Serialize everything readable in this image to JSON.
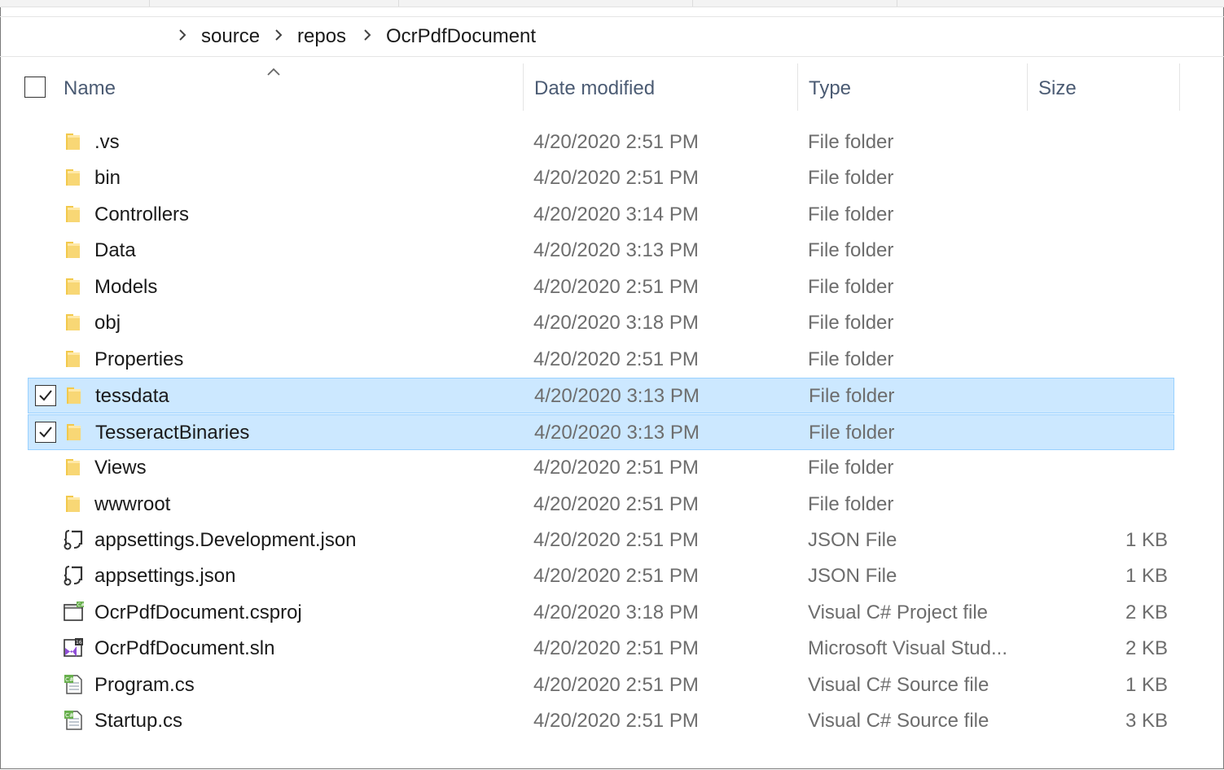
{
  "breadcrumb": {
    "items": [
      "source",
      "repos",
      "OcrPdfDocument"
    ]
  },
  "columns": {
    "name": "Name",
    "date_modified": "Date modified",
    "type": "Type",
    "size": "Size",
    "sort_icon": "chevron-up-icon"
  },
  "colors": {
    "selection_bg": "#cce8ff",
    "selection_border": "#99d1ff",
    "folder": "#f8d775",
    "header_text": "#4b5b73"
  },
  "files": [
    {
      "name": ".vs",
      "date": "4/20/2020 2:51 PM",
      "type": "File folder",
      "size": "",
      "icon": "folder-icon",
      "selected": false
    },
    {
      "name": "bin",
      "date": "4/20/2020 2:51 PM",
      "type": "File folder",
      "size": "",
      "icon": "folder-icon",
      "selected": false
    },
    {
      "name": "Controllers",
      "date": "4/20/2020 3:14 PM",
      "type": "File folder",
      "size": "",
      "icon": "folder-icon",
      "selected": false
    },
    {
      "name": "Data",
      "date": "4/20/2020 3:13 PM",
      "type": "File folder",
      "size": "",
      "icon": "folder-icon",
      "selected": false
    },
    {
      "name": "Models",
      "date": "4/20/2020 2:51 PM",
      "type": "File folder",
      "size": "",
      "icon": "folder-icon",
      "selected": false
    },
    {
      "name": "obj",
      "date": "4/20/2020 3:18 PM",
      "type": "File folder",
      "size": "",
      "icon": "folder-icon",
      "selected": false
    },
    {
      "name": "Properties",
      "date": "4/20/2020 2:51 PM",
      "type": "File folder",
      "size": "",
      "icon": "folder-icon",
      "selected": false
    },
    {
      "name": "tessdata",
      "date": "4/20/2020 3:13 PM",
      "type": "File folder",
      "size": "",
      "icon": "folder-icon",
      "selected": true
    },
    {
      "name": "TesseractBinaries",
      "date": "4/20/2020 3:13 PM",
      "type": "File folder",
      "size": "",
      "icon": "folder-icon",
      "selected": true
    },
    {
      "name": "Views",
      "date": "4/20/2020 2:51 PM",
      "type": "File folder",
      "size": "",
      "icon": "folder-icon",
      "selected": false
    },
    {
      "name": "wwwroot",
      "date": "4/20/2020 2:51 PM",
      "type": "File folder",
      "size": "",
      "icon": "folder-icon",
      "selected": false
    },
    {
      "name": "appsettings.Development.json",
      "date": "4/20/2020 2:51 PM",
      "type": "JSON File",
      "size": "1 KB",
      "icon": "json-file-icon",
      "selected": false
    },
    {
      "name": "appsettings.json",
      "date": "4/20/2020 2:51 PM",
      "type": "JSON File",
      "size": "1 KB",
      "icon": "json-file-icon",
      "selected": false
    },
    {
      "name": "OcrPdfDocument.csproj",
      "date": "4/20/2020 3:18 PM",
      "type": "Visual C# Project file",
      "size": "2 KB",
      "icon": "csproj-file-icon",
      "selected": false
    },
    {
      "name": "OcrPdfDocument.sln",
      "date": "4/20/2020 2:51 PM",
      "type": "Microsoft Visual Stud...",
      "size": "2 KB",
      "icon": "sln-file-icon",
      "selected": false
    },
    {
      "name": "Program.cs",
      "date": "4/20/2020 2:51 PM",
      "type": "Visual C# Source file",
      "size": "1 KB",
      "icon": "cs-file-icon",
      "selected": false
    },
    {
      "name": "Startup.cs",
      "date": "4/20/2020 2:51 PM",
      "type": "Visual C# Source file",
      "size": "3 KB",
      "icon": "cs-file-icon",
      "selected": false
    }
  ]
}
